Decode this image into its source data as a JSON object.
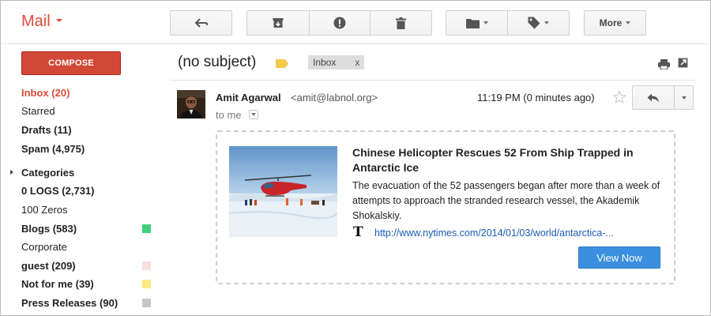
{
  "app": {
    "title": "Mail"
  },
  "toolbar": {
    "more_label": "More"
  },
  "sidebar": {
    "compose_label": "COMPOSE",
    "items": [
      {
        "label": "Inbox (20)",
        "state": "active"
      },
      {
        "label": "Starred"
      },
      {
        "label": "Drafts (11)"
      },
      {
        "label": "Spam (4,975)"
      },
      {
        "label": "Categories"
      },
      {
        "label": "0 LOGS (2,731)"
      },
      {
        "label": "100 Zeros"
      },
      {
        "label": "Blogs (583)",
        "color": "#3fcf7a"
      },
      {
        "label": "Corporate"
      },
      {
        "label": "guest (209)",
        "color": "#f7dede"
      },
      {
        "label": "Not for me (39)",
        "color": "#fbe983"
      },
      {
        "label": "Press Releases (90)",
        "color": "#c6c6c6"
      }
    ]
  },
  "message": {
    "subject": "(no subject)",
    "label": "Inbox",
    "label_remove": "x",
    "sender_name": "Amit Agarwal",
    "sender_email": "<amit@labnol.org>",
    "to_line": "to me",
    "timestamp": "11:19 PM (0 minutes ago)"
  },
  "preview": {
    "title": "Chinese Helicopter Rescues 52 From Ship Trapped in Antarctic Ice",
    "description": "The evacuation of the 52 passengers began after more than a week of attempts to approach the stranded research vessel, the Akademik Shokalskiy.",
    "source_icon": "𝕿",
    "url": "http://www.nytimes.com/2014/01/03/world/antarctica-...",
    "button_label": "View Now"
  }
}
